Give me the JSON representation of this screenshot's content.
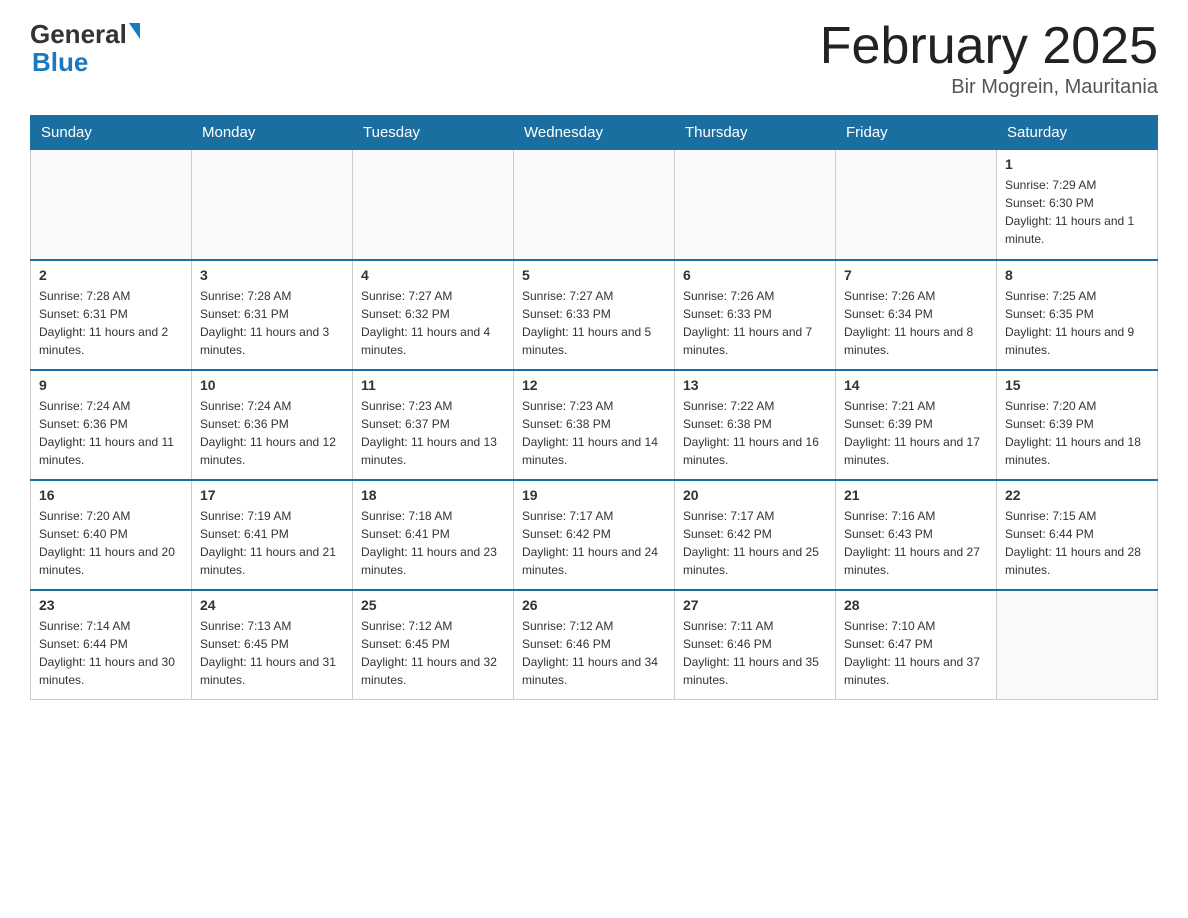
{
  "header": {
    "logo_general": "General",
    "logo_blue": "Blue",
    "month_title": "February 2025",
    "location": "Bir Mogrein, Mauritania"
  },
  "days_of_week": [
    "Sunday",
    "Monday",
    "Tuesday",
    "Wednesday",
    "Thursday",
    "Friday",
    "Saturday"
  ],
  "weeks": [
    [
      {
        "num": "",
        "info": ""
      },
      {
        "num": "",
        "info": ""
      },
      {
        "num": "",
        "info": ""
      },
      {
        "num": "",
        "info": ""
      },
      {
        "num": "",
        "info": ""
      },
      {
        "num": "",
        "info": ""
      },
      {
        "num": "1",
        "info": "Sunrise: 7:29 AM\nSunset: 6:30 PM\nDaylight: 11 hours and 1 minute."
      }
    ],
    [
      {
        "num": "2",
        "info": "Sunrise: 7:28 AM\nSunset: 6:31 PM\nDaylight: 11 hours and 2 minutes."
      },
      {
        "num": "3",
        "info": "Sunrise: 7:28 AM\nSunset: 6:31 PM\nDaylight: 11 hours and 3 minutes."
      },
      {
        "num": "4",
        "info": "Sunrise: 7:27 AM\nSunset: 6:32 PM\nDaylight: 11 hours and 4 minutes."
      },
      {
        "num": "5",
        "info": "Sunrise: 7:27 AM\nSunset: 6:33 PM\nDaylight: 11 hours and 5 minutes."
      },
      {
        "num": "6",
        "info": "Sunrise: 7:26 AM\nSunset: 6:33 PM\nDaylight: 11 hours and 7 minutes."
      },
      {
        "num": "7",
        "info": "Sunrise: 7:26 AM\nSunset: 6:34 PM\nDaylight: 11 hours and 8 minutes."
      },
      {
        "num": "8",
        "info": "Sunrise: 7:25 AM\nSunset: 6:35 PM\nDaylight: 11 hours and 9 minutes."
      }
    ],
    [
      {
        "num": "9",
        "info": "Sunrise: 7:24 AM\nSunset: 6:36 PM\nDaylight: 11 hours and 11 minutes."
      },
      {
        "num": "10",
        "info": "Sunrise: 7:24 AM\nSunset: 6:36 PM\nDaylight: 11 hours and 12 minutes."
      },
      {
        "num": "11",
        "info": "Sunrise: 7:23 AM\nSunset: 6:37 PM\nDaylight: 11 hours and 13 minutes."
      },
      {
        "num": "12",
        "info": "Sunrise: 7:23 AM\nSunset: 6:38 PM\nDaylight: 11 hours and 14 minutes."
      },
      {
        "num": "13",
        "info": "Sunrise: 7:22 AM\nSunset: 6:38 PM\nDaylight: 11 hours and 16 minutes."
      },
      {
        "num": "14",
        "info": "Sunrise: 7:21 AM\nSunset: 6:39 PM\nDaylight: 11 hours and 17 minutes."
      },
      {
        "num": "15",
        "info": "Sunrise: 7:20 AM\nSunset: 6:39 PM\nDaylight: 11 hours and 18 minutes."
      }
    ],
    [
      {
        "num": "16",
        "info": "Sunrise: 7:20 AM\nSunset: 6:40 PM\nDaylight: 11 hours and 20 minutes."
      },
      {
        "num": "17",
        "info": "Sunrise: 7:19 AM\nSunset: 6:41 PM\nDaylight: 11 hours and 21 minutes."
      },
      {
        "num": "18",
        "info": "Sunrise: 7:18 AM\nSunset: 6:41 PM\nDaylight: 11 hours and 23 minutes."
      },
      {
        "num": "19",
        "info": "Sunrise: 7:17 AM\nSunset: 6:42 PM\nDaylight: 11 hours and 24 minutes."
      },
      {
        "num": "20",
        "info": "Sunrise: 7:17 AM\nSunset: 6:42 PM\nDaylight: 11 hours and 25 minutes."
      },
      {
        "num": "21",
        "info": "Sunrise: 7:16 AM\nSunset: 6:43 PM\nDaylight: 11 hours and 27 minutes."
      },
      {
        "num": "22",
        "info": "Sunrise: 7:15 AM\nSunset: 6:44 PM\nDaylight: 11 hours and 28 minutes."
      }
    ],
    [
      {
        "num": "23",
        "info": "Sunrise: 7:14 AM\nSunset: 6:44 PM\nDaylight: 11 hours and 30 minutes."
      },
      {
        "num": "24",
        "info": "Sunrise: 7:13 AM\nSunset: 6:45 PM\nDaylight: 11 hours and 31 minutes."
      },
      {
        "num": "25",
        "info": "Sunrise: 7:12 AM\nSunset: 6:45 PM\nDaylight: 11 hours and 32 minutes."
      },
      {
        "num": "26",
        "info": "Sunrise: 7:12 AM\nSunset: 6:46 PM\nDaylight: 11 hours and 34 minutes."
      },
      {
        "num": "27",
        "info": "Sunrise: 7:11 AM\nSunset: 6:46 PM\nDaylight: 11 hours and 35 minutes."
      },
      {
        "num": "28",
        "info": "Sunrise: 7:10 AM\nSunset: 6:47 PM\nDaylight: 11 hours and 37 minutes."
      },
      {
        "num": "",
        "info": ""
      }
    ]
  ]
}
